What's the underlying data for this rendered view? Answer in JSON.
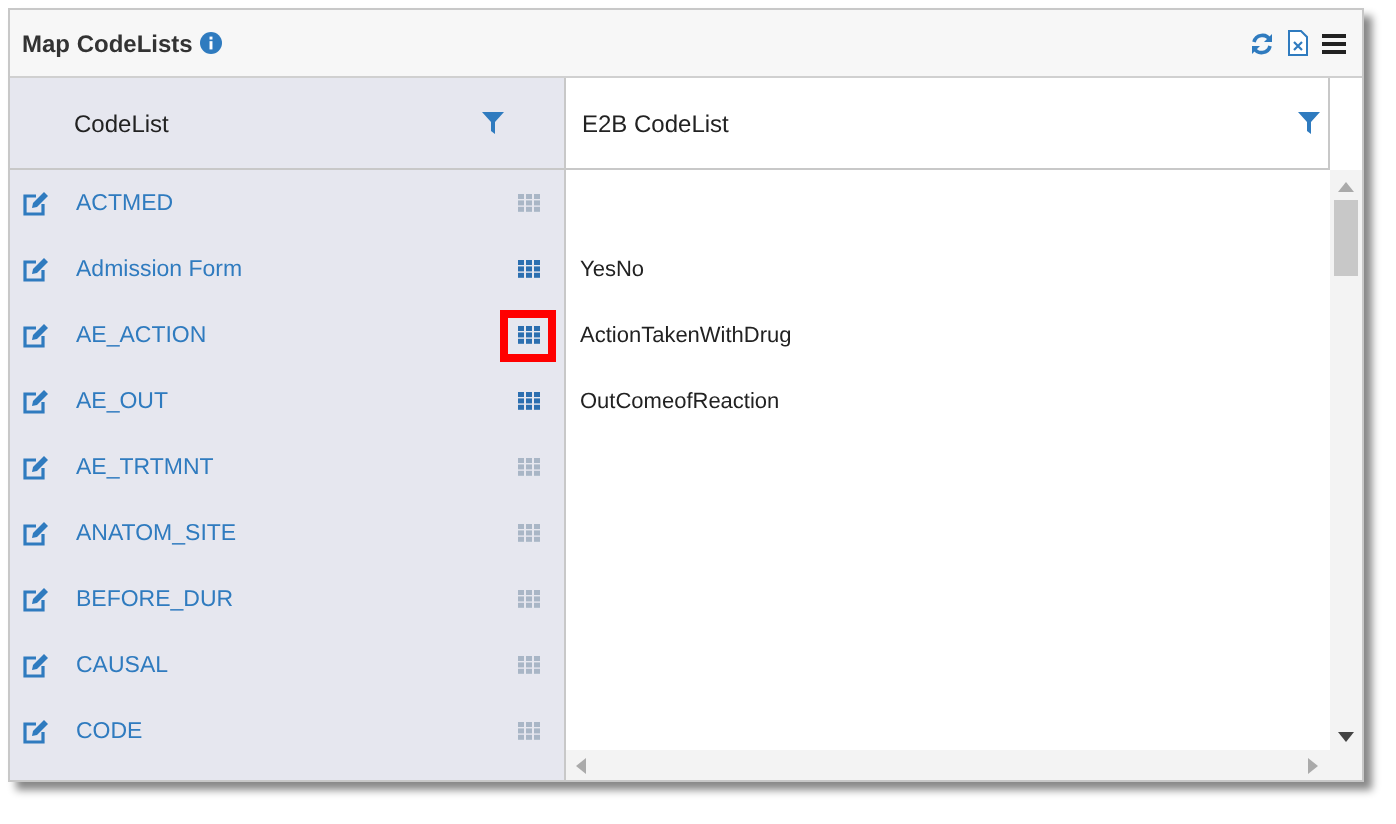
{
  "panel": {
    "title": "Map CodeLists"
  },
  "columns": [
    "CodeList",
    "E2B CodeList"
  ],
  "rows": [
    {
      "codelist": "ACTMED",
      "mapped": false,
      "highlighted": false
    },
    {
      "codelist": "Admission Form",
      "mapped": true,
      "highlighted": false,
      "e2b": "YesNo"
    },
    {
      "codelist": "AE_ACTION",
      "mapped": true,
      "highlighted": true,
      "e2b": "ActionTakenWithDrug"
    },
    {
      "codelist": "AE_OUT",
      "mapped": true,
      "highlighted": false,
      "e2b": "OutComeofReaction"
    },
    {
      "codelist": "AE_TRTMNT",
      "mapped": false,
      "highlighted": false
    },
    {
      "codelist": "ANATOM_SITE",
      "mapped": false,
      "highlighted": false
    },
    {
      "codelist": "BEFORE_DUR",
      "mapped": false,
      "highlighted": false
    },
    {
      "codelist": "CAUSAL",
      "mapped": false,
      "highlighted": false
    },
    {
      "codelist": "CODE",
      "mapped": false,
      "highlighted": false
    }
  ]
}
